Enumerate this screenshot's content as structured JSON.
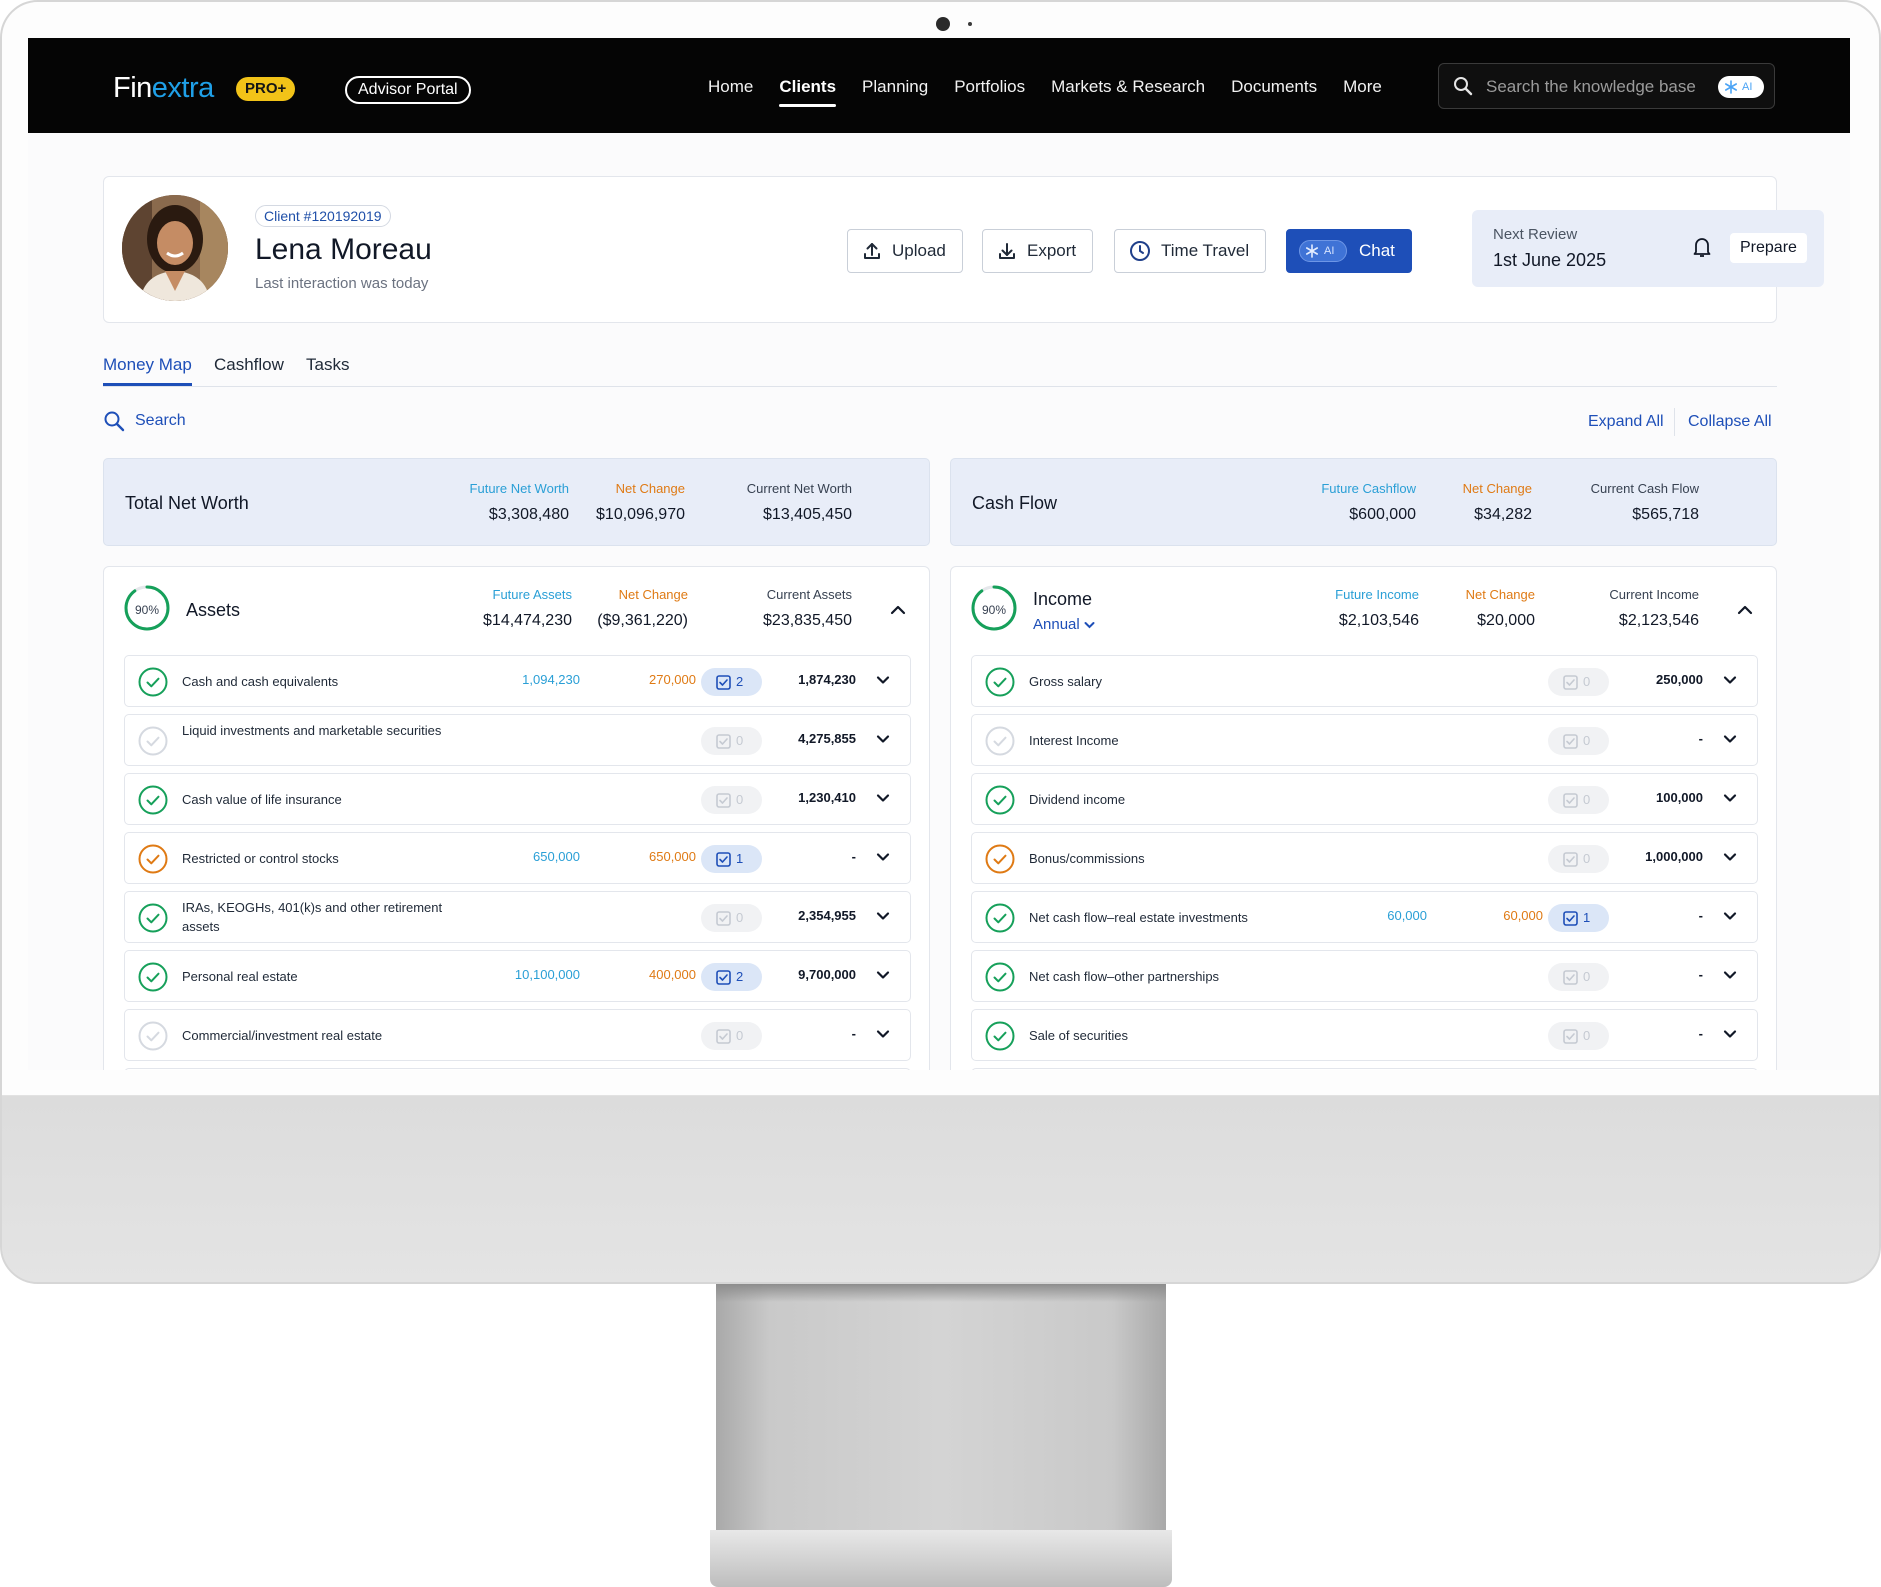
{
  "brand": {
    "logo_a": "Fin",
    "logo_b": "extra",
    "badge": "PRO+",
    "portal": "Advisor Portal"
  },
  "nav": [
    {
      "label": "Home"
    },
    {
      "label": "Clients",
      "active": true
    },
    {
      "label": "Planning"
    },
    {
      "label": "Portfolios"
    },
    {
      "label": "Markets & Research"
    },
    {
      "label": "Documents"
    },
    {
      "label": "More"
    }
  ],
  "kb_search": {
    "placeholder": "Search the knowledge base",
    "ai": "AI"
  },
  "client": {
    "id": "Client #120192019",
    "name": "Lena Moreau",
    "last_interaction": "Last interaction was today",
    "buttons": {
      "upload": "Upload",
      "export": "Export",
      "time_travel": "Time Travel",
      "chat": "Chat",
      "chat_ai": "AI"
    },
    "review": {
      "label": "Next Review",
      "date": "1st June 2025",
      "prepare": "Prepare"
    }
  },
  "tabs": [
    {
      "label": "Money Map",
      "active": true
    },
    {
      "label": "Cashflow"
    },
    {
      "label": "Tasks"
    }
  ],
  "toolbar": {
    "search": "Search",
    "expand": "Expand All",
    "collapse": "Collapse All"
  },
  "net_worth": {
    "title": "Total Net Worth",
    "future_label": "Future Net Worth",
    "future": "$3,308,480",
    "net_label": "Net Change",
    "net": "$10,096,970",
    "current_label": "Current Net Worth",
    "current": "$13,405,450"
  },
  "cash_flow": {
    "title": "Cash Flow",
    "future_label": "Future Cashflow",
    "future": "$600,000",
    "net_label": "Net Change",
    "net": "$34,282",
    "current_label": "Current Cash Flow",
    "current": "$565,718"
  },
  "assets": {
    "progress": "90%",
    "progress_value": 0.9,
    "title": "Assets",
    "future_label": "Future Assets",
    "future": "$14,474,230",
    "net_label": "Net Change",
    "net": "($9,361,220)",
    "current_label": "Current Assets",
    "current": "$23,835,450",
    "rows": [
      {
        "label": "Cash and cash equivalents",
        "status": "complete",
        "future": "1,094,230",
        "net": "270,000",
        "tasks": "2",
        "active": true,
        "current": "1,874,230"
      },
      {
        "label": "Liquid investments and marketable securities",
        "status": "empty",
        "future": "",
        "net": "",
        "tasks": "0",
        "active": false,
        "current": "4,275,855"
      },
      {
        "label": "Cash value of life insurance",
        "status": "complete",
        "future": "",
        "net": "",
        "tasks": "0",
        "active": false,
        "current": "1,230,410"
      },
      {
        "label": "Restricted or control stocks",
        "status": "warning",
        "future": "650,000",
        "net": "650,000",
        "tasks": "1",
        "active": true,
        "current": "-"
      },
      {
        "label": "IRAs, KEOGHs, 401(k)s and other retirement assets",
        "status": "complete",
        "future": "",
        "net": "",
        "tasks": "0",
        "active": false,
        "current": "2,354,955"
      },
      {
        "label": "Personal real estate",
        "status": "complete",
        "future": "10,100,000",
        "net": "400,000",
        "tasks": "2",
        "active": true,
        "current": "9,700,000"
      },
      {
        "label": "Commercial/investment real estate",
        "status": "empty",
        "future": "",
        "net": "",
        "tasks": "0",
        "active": false,
        "current": "-"
      }
    ]
  },
  "income": {
    "progress": "90%",
    "progress_value": 0.9,
    "title": "Income",
    "period": "Annual",
    "future_label": "Future Income",
    "future": "$2,103,546",
    "net_label": "Net Change",
    "net": "$20,000",
    "current_label": "Current Income",
    "current": "$2,123,546",
    "rows": [
      {
        "label": "Gross salary",
        "status": "complete",
        "future": "",
        "net": "",
        "tasks": "0",
        "active": false,
        "current": "250,000"
      },
      {
        "label": "Interest Income",
        "status": "empty",
        "future": "",
        "net": "",
        "tasks": "0",
        "active": false,
        "current": "-"
      },
      {
        "label": "Dividend income",
        "status": "complete",
        "future": "",
        "net": "",
        "tasks": "0",
        "active": false,
        "current": "100,000"
      },
      {
        "label": "Bonus/commissions",
        "status": "warning",
        "future": "",
        "net": "",
        "tasks": "0",
        "active": false,
        "current": "1,000,000"
      },
      {
        "label": "Net cash flow–real estate investments",
        "status": "complete",
        "future": "60,000",
        "net": "60,000",
        "tasks": "1",
        "active": true,
        "current": "-"
      },
      {
        "label": "Net cash flow–other partnerships",
        "status": "complete",
        "future": "",
        "net": "",
        "tasks": "0",
        "active": false,
        "current": "-"
      },
      {
        "label": "Sale of securities",
        "status": "complete",
        "future": "",
        "net": "",
        "tasks": "0",
        "active": false,
        "current": "-"
      }
    ]
  },
  "colors": {
    "accent": "#1e4fb8",
    "future": "#2a9fd6",
    "net_change": "#df7a14",
    "complete": "#16a05a",
    "warning": "#df7a14",
    "empty": "#d5d9e0"
  }
}
